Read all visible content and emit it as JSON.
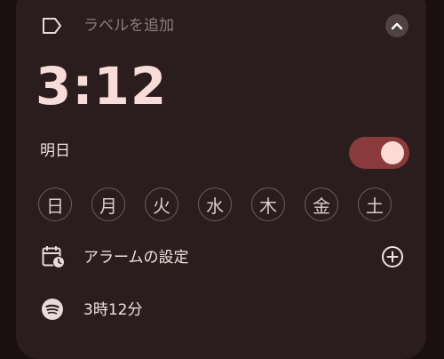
{
  "label": {
    "add_label": "ラベルを追加"
  },
  "alarm": {
    "time": "3:12",
    "schedule": "明日",
    "enabled": true
  },
  "days": [
    "日",
    "月",
    "火",
    "水",
    "木",
    "金",
    "土"
  ],
  "settings_row": {
    "label": "アラームの設定"
  },
  "sound_row": {
    "label": "3時12分"
  },
  "colors": {
    "card_bg": "#2b1d1d",
    "time_text": "#f7dcd9",
    "toggle_track": "#8a3a3a",
    "toggle_knob": "#ffd9d6"
  }
}
